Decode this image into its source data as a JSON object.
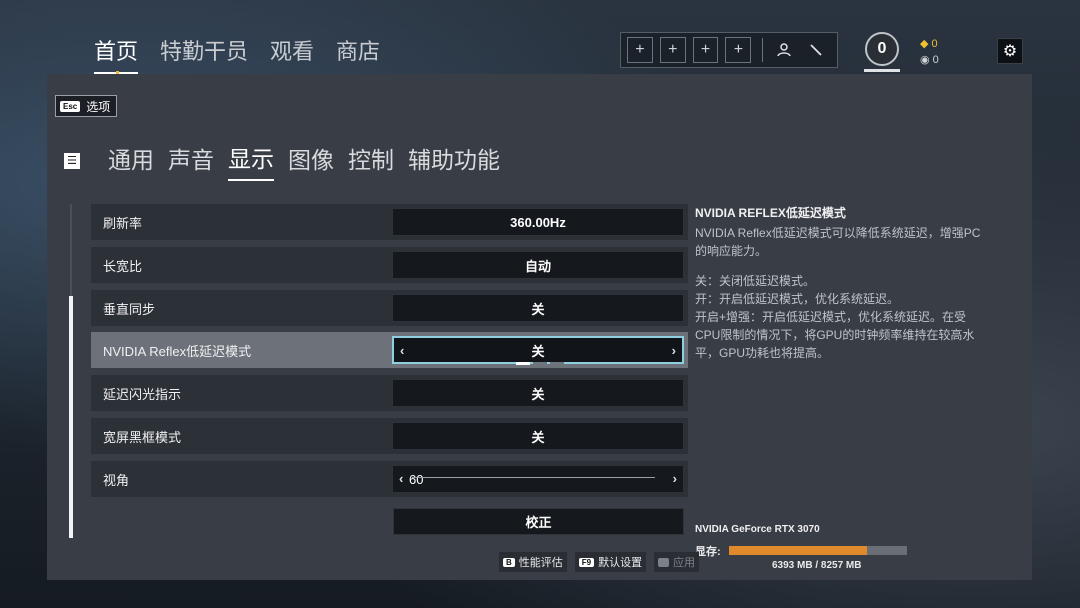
{
  "nav": {
    "items": [
      "首页",
      "特勤干员",
      "观看",
      "商店"
    ],
    "active": 0
  },
  "squad": {
    "slots": [
      "+",
      "+",
      "+",
      "+"
    ]
  },
  "rank": {
    "value": "0"
  },
  "currency": {
    "renown": "0",
    "credits": "0"
  },
  "esc": {
    "key": "Esc",
    "label": "选项"
  },
  "tabs": {
    "items": [
      "通用",
      "声音",
      "显示",
      "图像",
      "控制",
      "辅助功能"
    ],
    "active": 2
  },
  "settings": [
    {
      "label": "刷新率",
      "value": "360.00Hz"
    },
    {
      "label": "长宽比",
      "value": "自动"
    },
    {
      "label": "垂直同步",
      "value": "关"
    },
    {
      "label": "NVIDIA Reflex低延迟模式",
      "value": "关"
    },
    {
      "label": "延迟闪光指示",
      "value": "关"
    },
    {
      "label": "宽屏黑框模式",
      "value": "关"
    },
    {
      "label": "视角",
      "value": "60"
    }
  ],
  "calibrate": {
    "label": "校正"
  },
  "info": {
    "title": "NVIDIA REFLEX低延迟模式",
    "desc": "NVIDIA Reflex低延迟模式可以降低系统延迟，增强PC的响应能力。",
    "off": "关：关闭低延迟模式。",
    "on": "开：开启低延迟模式，优化系统延迟。",
    "boost": "开启+增强：开启低延迟模式，优化系统延迟。在受CPU限制的情况下，将GPU的时钟频率维持在较高水平，GPU功耗也将提高。"
  },
  "gpu": {
    "name": "NVIDIA GeForce RTX 3070",
    "vram_label": "显存:",
    "vram_text": "6393 MB / 8257 MB",
    "vram_fraction": 0.774
  },
  "footer": {
    "bench_key": "B",
    "bench_label": "性能评估",
    "default_key": "F9",
    "default_label": "默认设置",
    "apply_key": "",
    "apply_label": "应用"
  },
  "colors": {
    "accent": "#8fd0e0",
    "vram": "#e08a2c",
    "gold": "#f0c030"
  }
}
